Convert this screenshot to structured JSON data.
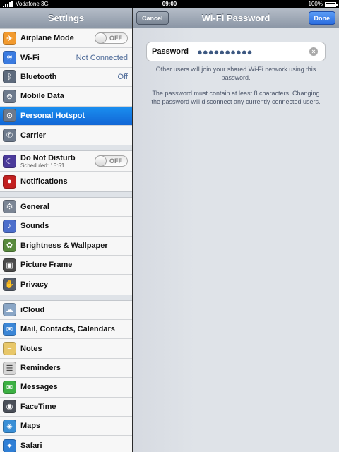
{
  "statusbar": {
    "carrier": "Vodafone 3G",
    "time": "09:00",
    "battery": "100%"
  },
  "settings": {
    "title": "Settings",
    "groups": [
      [
        {
          "label": "Airplane Mode",
          "icon": "airplane-icon",
          "toggle": "OFF"
        },
        {
          "label": "Wi-Fi",
          "icon": "wifi-icon",
          "value": "Not Connected"
        },
        {
          "label": "Bluetooth",
          "icon": "bluetooth-icon",
          "value": "Off"
        },
        {
          "label": "Mobile Data",
          "icon": "antenna-icon"
        },
        {
          "label": "Personal Hotspot",
          "icon": "hotspot-icon",
          "selected": true
        },
        {
          "label": "Carrier",
          "icon": "phone-icon"
        }
      ],
      [
        {
          "label": "Do Not Disturb",
          "sub": "Scheduled: 15:51",
          "icon": "moon-icon",
          "toggle": "OFF"
        },
        {
          "label": "Notifications",
          "icon": "notifications-icon"
        }
      ],
      [
        {
          "label": "General",
          "icon": "gear-icon"
        },
        {
          "label": "Sounds",
          "icon": "speaker-icon"
        },
        {
          "label": "Brightness & Wallpaper",
          "icon": "flower-icon"
        },
        {
          "label": "Picture Frame",
          "icon": "picture-frame-icon"
        },
        {
          "label": "Privacy",
          "icon": "hand-icon"
        }
      ],
      [
        {
          "label": "iCloud",
          "icon": "cloud-icon"
        },
        {
          "label": "Mail, Contacts, Calendars",
          "icon": "mail-icon"
        },
        {
          "label": "Notes",
          "icon": "notes-icon"
        },
        {
          "label": "Reminders",
          "icon": "reminders-icon"
        },
        {
          "label": "Messages",
          "icon": "messages-icon"
        },
        {
          "label": "FaceTime",
          "icon": "facetime-icon"
        },
        {
          "label": "Maps",
          "icon": "maps-icon"
        },
        {
          "label": "Safari",
          "icon": "safari-icon"
        }
      ]
    ]
  },
  "wifi_password": {
    "title": "Wi-Fi Password",
    "cancel_label": "Cancel",
    "done_label": "Done",
    "field_label": "Password",
    "field_value": "●●●●●●●●●●",
    "note1": "Other users will join your shared Wi-Fi network using this password.",
    "note2": "The password must contain at least 8 characters. Changing the password will disconnect any currently connected users."
  },
  "colors": {
    "selected": "#1a7ae6",
    "nav_bar": "#9aa4b2",
    "done_button": "#3b7de8",
    "value_text": "#4d6a98"
  }
}
